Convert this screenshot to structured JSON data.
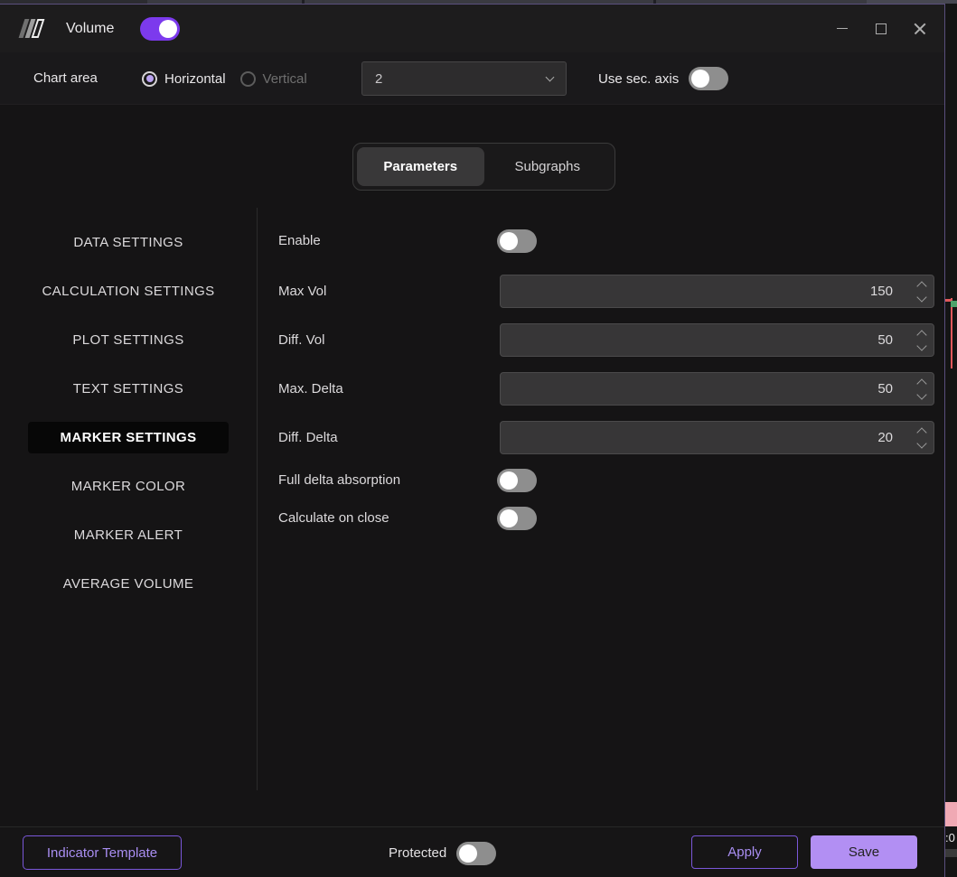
{
  "titlebar": {
    "title": "Volume",
    "indicator_enabled": true
  },
  "controls_bar": {
    "chart_area_label": "Chart area",
    "orientation_options": [
      {
        "label": "Horizontal",
        "selected": true
      },
      {
        "label": "Vertical",
        "selected": false
      }
    ],
    "chart_area_value": "2",
    "use_sec_axis_label": "Use sec. axis",
    "use_sec_axis_enabled": false
  },
  "tabs": {
    "items": [
      {
        "label": "Parameters",
        "active": true
      },
      {
        "label": "Subgraphs",
        "active": false
      }
    ]
  },
  "sidebar": {
    "items": [
      {
        "label": "DATA SETTINGS",
        "active": false
      },
      {
        "label": "CALCULATION SETTINGS",
        "active": false
      },
      {
        "label": "PLOT SETTINGS",
        "active": false
      },
      {
        "label": "TEXT SETTINGS",
        "active": false
      },
      {
        "label": "MARKER SETTINGS",
        "active": true
      },
      {
        "label": "MARKER COLOR",
        "active": false
      },
      {
        "label": "MARKER ALERT",
        "active": false
      },
      {
        "label": "AVERAGE VOLUME",
        "active": false
      }
    ]
  },
  "parameters": {
    "enable": {
      "label": "Enable",
      "enabled": false
    },
    "max_vol": {
      "label": "Max Vol",
      "value": "150"
    },
    "diff_vol": {
      "label": "Diff. Vol",
      "value": "50"
    },
    "max_delta": {
      "label": "Max. Delta",
      "value": "50"
    },
    "diff_delta": {
      "label": "Diff. Delta",
      "value": "20"
    },
    "full_delta_absorption": {
      "label": "Full delta absorption",
      "enabled": false
    },
    "calculate_on_close": {
      "label": "Calculate on close",
      "enabled": false
    }
  },
  "footer": {
    "indicator_template_label": "Indicator Template",
    "protected_label": "Protected",
    "protected_enabled": false,
    "apply_label": "Apply",
    "save_label": "Save"
  },
  "underlying_chart": {
    "price_axis_label": ":0"
  },
  "colors": {
    "accent_purple": "#7c3aed",
    "save_button_fill": "#b28ff3",
    "outline_button_purple": "#7a57d9",
    "outline_button_text": "#a98ef2",
    "window_border_purple": "#5a4f7d",
    "toggle_off_track": "#8e8e8e",
    "radio_selected_dot": "#b9a2ef",
    "candle_red": "#e2585c",
    "candle_green": "#4ea36a",
    "price_flag_pink": "#f0a9b4"
  }
}
